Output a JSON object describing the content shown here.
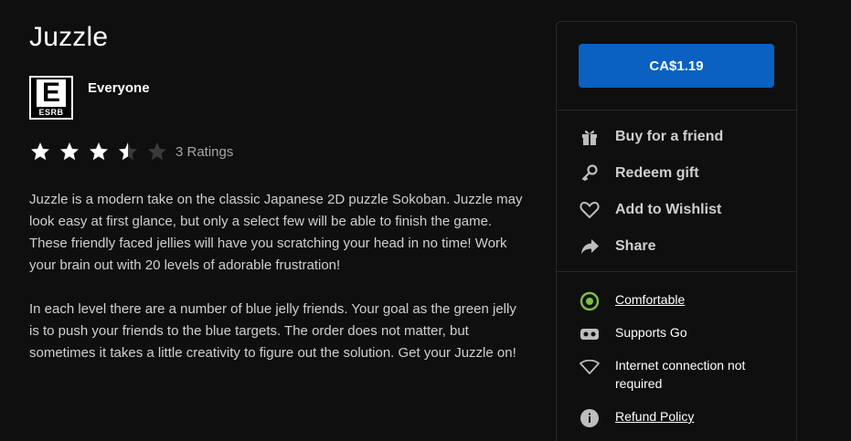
{
  "product": {
    "title": "Juzzle",
    "esrb": {
      "letter": "E",
      "org": "ESRB",
      "rating_label": "Everyone"
    },
    "rating": {
      "stars": 3.5,
      "max": 5,
      "count_label": "3 Ratings"
    },
    "description": [
      "Juzzle is a modern take on the classic Japanese 2D puzzle Sokoban. Juzzle may look easy at first glance, but only a select few will be able to finish the game. These friendly faced jellies will have you scratching your head in no time! Work your brain out with 20 levels of adorable frustration!",
      "In each level there are a number of blue jelly friends. Your goal as the green jelly is to push your friends to the blue targets. The order does not matter, but sometimes it takes a little creativity to figure out the solution. Get your Juzzle on!"
    ]
  },
  "purchase": {
    "price_label": "CA$1.19",
    "actions": [
      {
        "label": "Buy for a friend",
        "icon": "gift-icon"
      },
      {
        "label": "Redeem gift",
        "icon": "key-icon"
      },
      {
        "label": "Add to Wishlist",
        "icon": "heart-icon"
      },
      {
        "label": "Share",
        "icon": "share-icon"
      }
    ],
    "info": [
      {
        "label": "Comfortable",
        "icon": "comfort-icon",
        "link": true
      },
      {
        "label": "Supports Go",
        "icon": "headset-icon",
        "link": false
      },
      {
        "label": "Internet connection not required",
        "icon": "wifi-icon",
        "link": false
      },
      {
        "label": "Refund Policy",
        "icon": "info-icon",
        "link": true
      }
    ]
  },
  "colors": {
    "background": "#0f0f10",
    "accent": "#0a61c2",
    "comfort": "#7bc142",
    "text_muted": "#cfcfcf"
  }
}
